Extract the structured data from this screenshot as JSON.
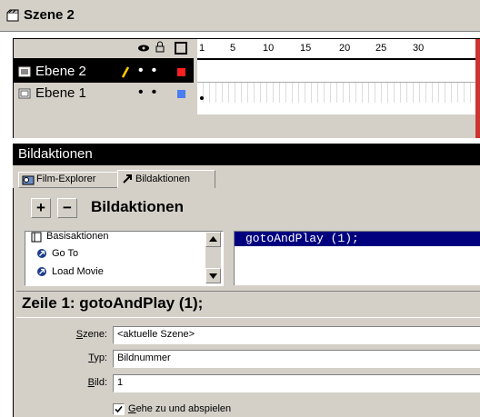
{
  "window": {
    "title": "Szene 2"
  },
  "timeline": {
    "ruler_labels": [
      "1",
      "5",
      "10",
      "15",
      "20",
      "25",
      "30"
    ],
    "layers": [
      {
        "name": "Ebene 2",
        "color": "#ff2020"
      },
      {
        "name": "Ebene 1",
        "color": "#4a7df0"
      }
    ]
  },
  "panel": {
    "title": "Bildaktionen",
    "tabs": [
      "Film-Explorer",
      "Bildaktionen"
    ],
    "add_label": "+",
    "remove_label": "−",
    "header_label": "Bildaktionen",
    "list_items": [
      "Basisaktionen",
      "Go To",
      "Load Movie"
    ],
    "code_line": "gotoAndPlay (1);",
    "status": "Zeile 1: gotoAndPlay (1);",
    "fields": {
      "scene_label": "Szene:",
      "scene_value": "<aktuelle Szene>",
      "type_label": "Typ:",
      "type_value": "Bildnummer",
      "frame_label": "Bild:",
      "frame_value": "1"
    },
    "checkbox_label": "Gehe zu und abspielen",
    "checkbox_checked": true
  }
}
